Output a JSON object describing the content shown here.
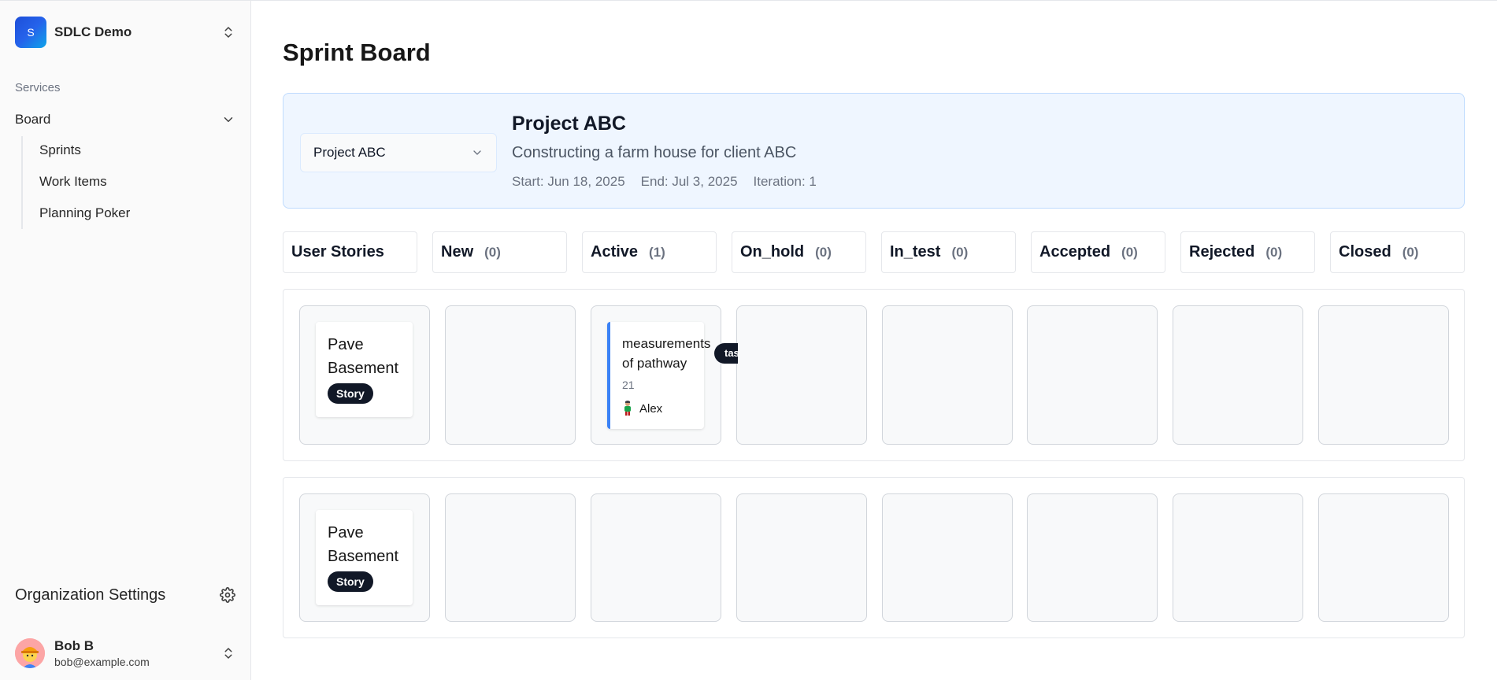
{
  "sidebar": {
    "org_initial": "S",
    "org_name": "SDLC Demo",
    "section_label": "Services",
    "board_label": "Board",
    "sub_items": [
      "Sprints",
      "Work Items",
      "Planning Poker"
    ],
    "org_settings_label": "Organization Settings",
    "user_name": "Bob B",
    "user_email": "bob@example.com"
  },
  "page_title": "Sprint Board",
  "project": {
    "selected": "Project ABC",
    "name": "Project ABC",
    "description": "Constructing a farm house for client ABC",
    "start": "Start: Jun 18, 2025",
    "end": "End: Jul 3, 2025",
    "iteration": "Iteration: 1"
  },
  "columns": [
    {
      "title": "User Stories",
      "count": ""
    },
    {
      "title": "New",
      "count": "(0)"
    },
    {
      "title": "Active",
      "count": "(1)"
    },
    {
      "title": "On_hold",
      "count": "(0)"
    },
    {
      "title": "In_test",
      "count": "(0)"
    },
    {
      "title": "Accepted",
      "count": "(0)"
    },
    {
      "title": "Rejected",
      "count": "(0)"
    },
    {
      "title": "Closed",
      "count": "(0)"
    }
  ],
  "rows": [
    {
      "story": {
        "title": "Pave Basement",
        "badge": "Story"
      },
      "task": {
        "title_line1": "measurements",
        "title_line2": "of pathway",
        "points": "21",
        "assignee": "Alex",
        "tag": "task"
      }
    },
    {
      "story": {
        "title": "Pave Basement",
        "badge": "Story"
      }
    }
  ],
  "colors": {
    "accent": "#3b82f6",
    "panel_bg": "#eff6ff",
    "badge_bg": "#111827"
  },
  "icons": [
    "chevrons-up-down-icon",
    "chevron-down-icon",
    "gear-icon"
  ]
}
